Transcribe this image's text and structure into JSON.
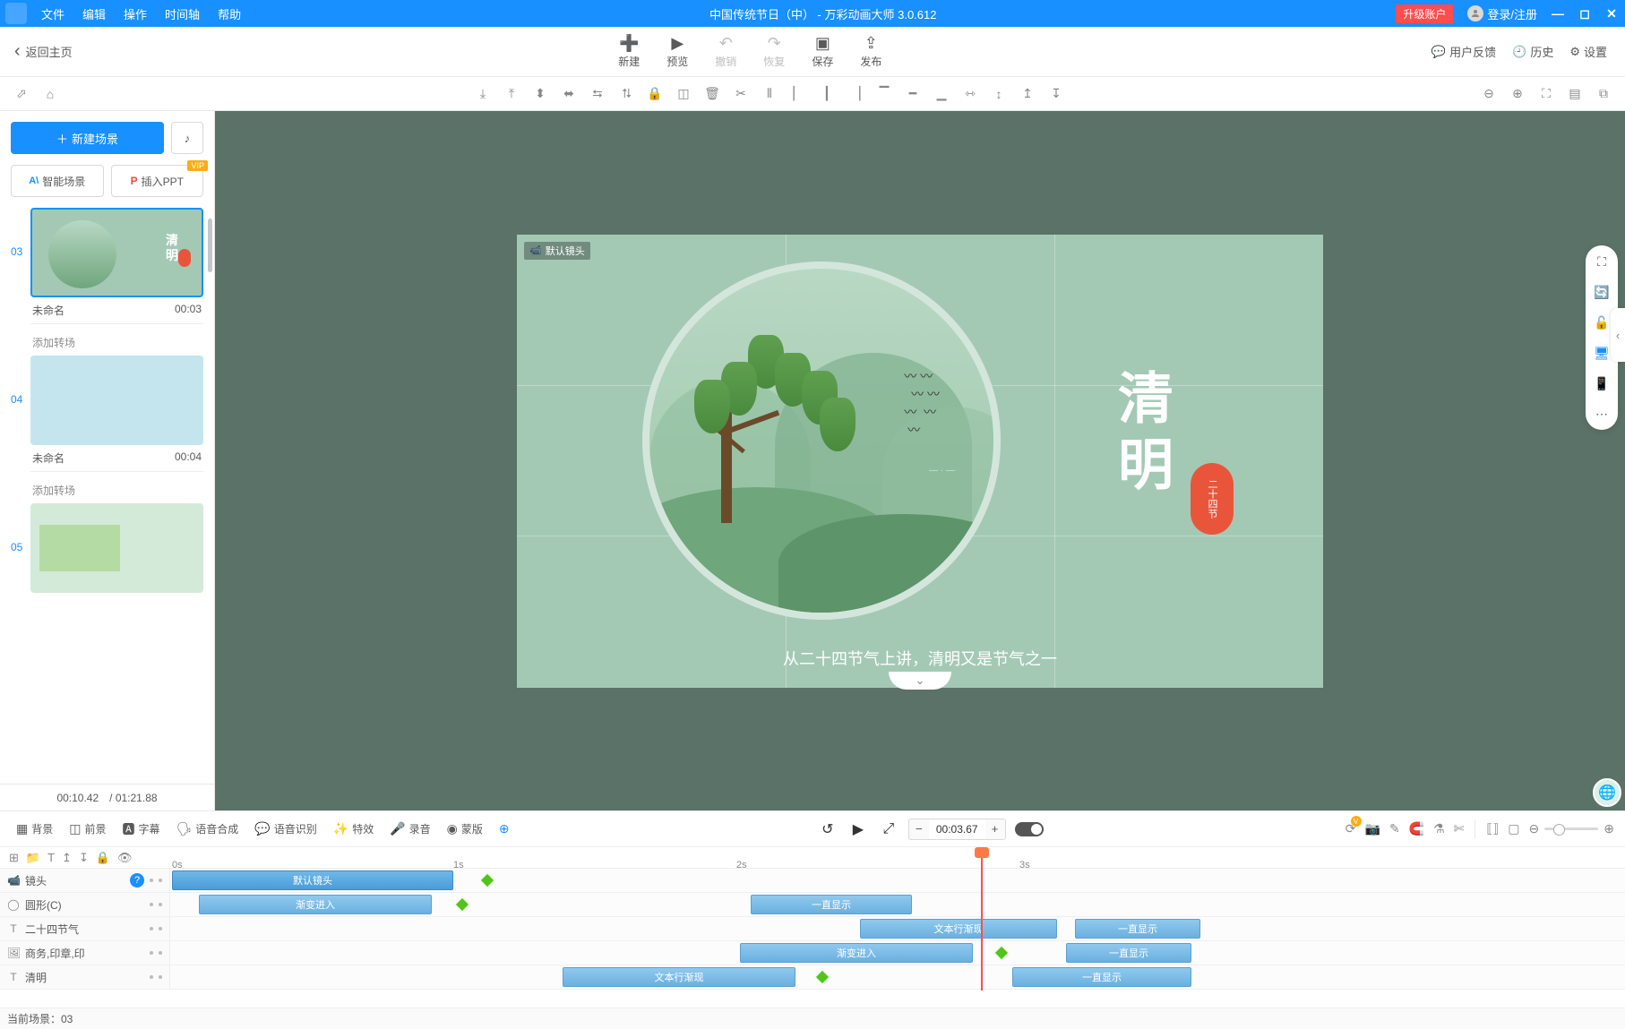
{
  "titlebar": {
    "menus": [
      "文件",
      "编辑",
      "操作",
      "时间轴",
      "帮助"
    ],
    "title": "中国传统节日（中） - 万彩动画大师 3.0.612",
    "upgrade": "升级账户",
    "login": "登录/注册"
  },
  "toolbar": {
    "back": "返回主页",
    "new": "新建",
    "preview": "预览",
    "undo": "撤销",
    "redo": "恢复",
    "save": "保存",
    "publish": "发布",
    "feedback": "用户反馈",
    "history": "历史",
    "settings": "设置"
  },
  "sidebar": {
    "new_scene": "新建场景",
    "smart_scene": "智能场景",
    "insert_ppt": "插入PPT",
    "vip": "VIP",
    "scenes": [
      {
        "num": "03",
        "name": "未命名",
        "time": "00:03",
        "thumb": "thumb03",
        "active": true
      },
      {
        "num": "04",
        "name": "未命名",
        "time": "00:04",
        "thumb": "thumb04"
      },
      {
        "num": "05",
        "name": "",
        "time": "",
        "thumb": "thumb05"
      }
    ],
    "transition": "添加转场",
    "footer_time": "00:10.42",
    "footer_total": "/ 01:21.88"
  },
  "canvas": {
    "camera_label": "默认镜头",
    "title": "清明",
    "seal": "二十四节",
    "subtitle": "从二十四节气上讲，清明又是节气之一"
  },
  "tl_toolbar": {
    "bg": "背景",
    "fg": "前景",
    "subtitle": "字幕",
    "tts": "语音合成",
    "asr": "语音识别",
    "fx": "特效",
    "record": "录音",
    "overlay": "蒙版",
    "time": "00:03.67"
  },
  "ruler": {
    "t0": "0s",
    "t1": "1s",
    "t2": "2s",
    "t3": "3s"
  },
  "tracks": {
    "camera": "镜头",
    "circle": "圆形(C)",
    "jieqi": "二十四节气",
    "seal": "商务,印章,印",
    "qingming": "清明"
  },
  "clips": {
    "default_camera": "默认镜头",
    "fade_in": "渐变进入",
    "always_show": "一直显示",
    "text_reveal": "文本行渐现"
  },
  "statusbar": {
    "current": "当前场景：03"
  }
}
